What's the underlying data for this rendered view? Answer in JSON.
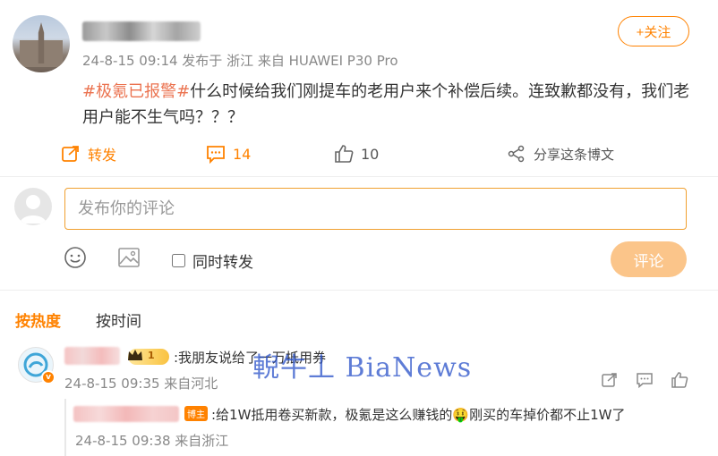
{
  "post": {
    "meta": "24-8-15 09:14 发布于 浙江 来自 HUAWEI P30 Pro",
    "follow_label": "+关注",
    "topic": "#极氪已报警#",
    "text": "什么时候给我们刚提车的老用户来个补偿后续。连致歉都没有，我们老用户能不生气吗？？？"
  },
  "actions": {
    "repost_label": "转发",
    "comment_count": "14",
    "like_count": "10",
    "share_label": "分享这条博文"
  },
  "composer": {
    "placeholder": "发布你的评论",
    "repost_checkbox_label": "同时转发",
    "submit_label": "评论"
  },
  "sort_tabs": {
    "hot": "按热度",
    "time": "按时间"
  },
  "comments": [
    {
      "level_badge": "1",
      "text": ":我朋友说给了一万抵用券",
      "meta": "24-8-15 09:35 来自河北",
      "replies": [
        {
          "author_badge": "博主",
          "text": ":给1W抵用卷买新款，极氪是这么赚钱的🤑刚买的车掉价都不止1W了",
          "meta": "24-8-15 09:38 来自浙江"
        }
      ]
    }
  ],
  "watermark": "輗牛丄 BiaNews",
  "colors": {
    "accent": "#ff8200",
    "topic": "#eb7350",
    "submit_disabled": "#fbc58a",
    "meta": "#888888"
  },
  "icons": [
    "repost-icon",
    "comment-icon",
    "like-icon",
    "share-icon",
    "emoji-icon",
    "image-icon",
    "reply-icon",
    "crown-icon"
  ]
}
